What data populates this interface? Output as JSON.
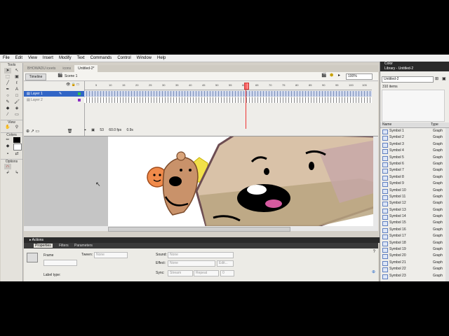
{
  "menu": [
    "File",
    "Edit",
    "View",
    "Insert",
    "Modify",
    "Text",
    "Commands",
    "Control",
    "Window",
    "Help"
  ],
  "tools": {
    "title": "Tools",
    "view_label": "View",
    "colors_label": "Colors",
    "options_label": "Options"
  },
  "doc_tabs": [
    "BHOWADU iceets",
    "icons",
    "Untitled-2*"
  ],
  "editbar": {
    "timeline_button": "Timeline",
    "scene": "Scene 1",
    "zoom": "100%"
  },
  "timeline": {
    "layers": [
      {
        "name": "Layer 1",
        "selected": true
      },
      {
        "name": "Layer 2",
        "selected": false
      }
    ],
    "ruler": [
      "5",
      "10",
      "15",
      "20",
      "25",
      "30",
      "35",
      "40",
      "45",
      "50",
      "55",
      "60",
      "65",
      "70",
      "75",
      "80",
      "85",
      "90",
      "95",
      "100",
      "105"
    ],
    "current_frame": "53",
    "fps": "60.0 fps",
    "time": "0.9s"
  },
  "panels": {
    "actions": "Actions",
    "tabs": [
      "Properties",
      "Filters",
      "Parameters"
    ],
    "frame_label": "Frame",
    "tween_label": "Tween:",
    "tween_value": "None",
    "sound_label": "Sound:",
    "sound_value": "None",
    "effect_label": "Effect:",
    "effect_value": "None",
    "edit_label": "Edit...",
    "sync_label": "Sync:",
    "sync_value": "Stream",
    "repeat_value": "Repeat",
    "repeat_count": "0",
    "label_type": "Label type:"
  },
  "right": {
    "color_title": "Color",
    "library_title": "Library - Untitled-2",
    "library_select": "Untitled-2",
    "item_count": "310 items",
    "col_name": "Name",
    "col_type": "Type",
    "items": [
      {
        "name": "Symbol 1",
        "type": "Graph"
      },
      {
        "name": "Symbol 2",
        "type": "Graph"
      },
      {
        "name": "Symbol 3",
        "type": "Graph"
      },
      {
        "name": "Symbol 4",
        "type": "Graph"
      },
      {
        "name": "Symbol 5",
        "type": "Graph"
      },
      {
        "name": "Symbol 6",
        "type": "Graph"
      },
      {
        "name": "Symbol 7",
        "type": "Graph"
      },
      {
        "name": "Symbol 8",
        "type": "Graph"
      },
      {
        "name": "Symbol 9",
        "type": "Graph"
      },
      {
        "name": "Symbol 10",
        "type": "Graph"
      },
      {
        "name": "Symbol 11",
        "type": "Graph"
      },
      {
        "name": "Symbol 12",
        "type": "Graph"
      },
      {
        "name": "Symbol 13",
        "type": "Graph"
      },
      {
        "name": "Symbol 14",
        "type": "Graph"
      },
      {
        "name": "Symbol 15",
        "type": "Graph"
      },
      {
        "name": "Symbol 16",
        "type": "Graph"
      },
      {
        "name": "Symbol 17",
        "type": "Graph"
      },
      {
        "name": "Symbol 18",
        "type": "Graph"
      },
      {
        "name": "Symbol 19",
        "type": "Graph"
      },
      {
        "name": "Symbol 20",
        "type": "Graph"
      },
      {
        "name": "Symbol 21",
        "type": "Graph"
      },
      {
        "name": "Symbol 22",
        "type": "Graph"
      },
      {
        "name": "Symbol 23",
        "type": "Graph"
      }
    ]
  }
}
